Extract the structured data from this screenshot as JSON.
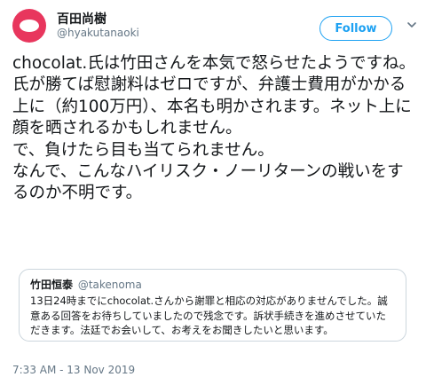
{
  "author": {
    "name": "百田尚樹",
    "handle": "@hyakutanaoki"
  },
  "actions": {
    "follow_label": "Follow"
  },
  "tweet": {
    "text": "chocolat.氏は竹田さんを本気で怒らせたようですね。\n氏が勝てば慰謝料はゼロですが、弁護士費用がかかる上に（約100万円）、本名も明かされます。ネット上に顔を晒されるかもしれません。\nで、負けたら目も当てられません。\nなんで、こんなハイリスク・ノーリターンの戦いをするのか不明です。",
    "timestamp": "7:33 AM - 13 Nov 2019"
  },
  "quoted_tweet": {
    "name": "竹田恒泰",
    "handle": "@takenoma",
    "text": "13日24時までにchocolat.さんから謝罪と相応の対応がありませんでした。誠意ある回答をお待ちしていましたので残念です。訴状手続きを進めさせていただきます。法廷でお会いして、お考えをお聞きしたいと思います。"
  },
  "icons": {
    "avatar": "avatar-logo",
    "menu": "chevron-down-icon"
  },
  "colors": {
    "accent": "#1da1f2",
    "avatar": "#e8365d",
    "secondary_text": "#657786",
    "border": "#ccd6dd"
  }
}
